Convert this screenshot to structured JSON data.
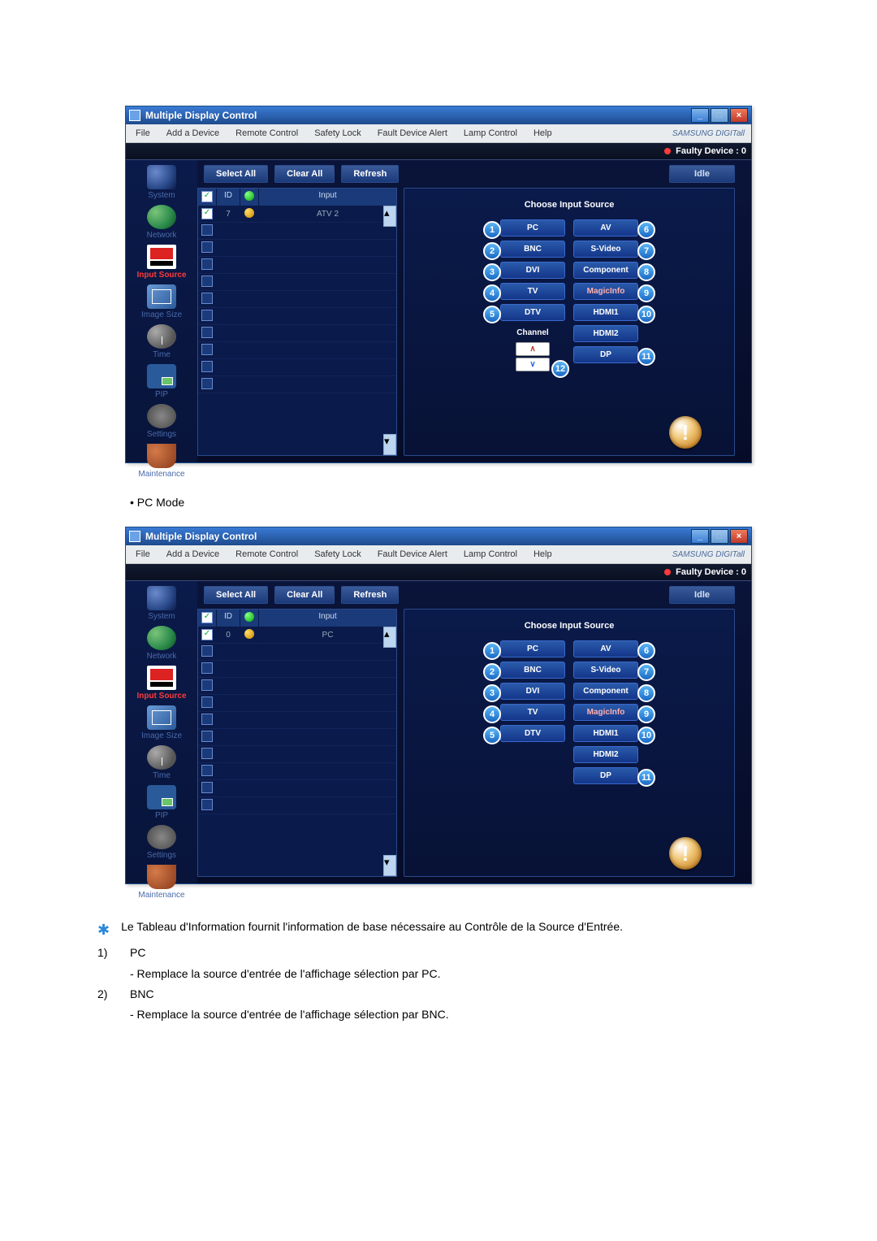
{
  "window": {
    "title": "Multiple Display Control",
    "brand": "SAMSUNG DIGITall"
  },
  "menu": [
    "File",
    "Add a Device",
    "Remote Control",
    "Safety Lock",
    "Fault Device Alert",
    "Lamp Control",
    "Help"
  ],
  "faulty": "Faulty Device : 0",
  "toolbar": {
    "select_all": "Select All",
    "clear_all": "Clear All",
    "refresh": "Refresh",
    "idle": "Idle"
  },
  "sidebar": [
    {
      "label": "System"
    },
    {
      "label": "Network"
    },
    {
      "label": "Input Source",
      "active": true
    },
    {
      "label": "Image Size"
    },
    {
      "label": "Time"
    },
    {
      "label": "PIP"
    },
    {
      "label": "Settings"
    },
    {
      "label": "Maintenance"
    }
  ],
  "grid": {
    "head": {
      "id": "ID",
      "input": "Input"
    },
    "row1_a": {
      "id": "7",
      "input": "ATV 2"
    },
    "row1_b": {
      "id": "0",
      "input": "PC"
    }
  },
  "panel": {
    "title": "Choose Input Source",
    "left": [
      "PC",
      "BNC",
      "DVI",
      "TV",
      "DTV"
    ],
    "right": [
      "AV",
      "S-Video",
      "Component",
      "MagicInfo",
      "HDMI1",
      "HDMI2",
      "DP"
    ],
    "left_nums": [
      "1",
      "2",
      "3",
      "4",
      "5"
    ],
    "right_nums": [
      "6",
      "7",
      "8",
      "9",
      "10",
      "",
      "11"
    ],
    "channel": "Channel",
    "ch_badge": "12"
  },
  "caption": "PC Mode",
  "notes": {
    "star": "Le Tableau d'Information fournit l'information de base nécessaire au Contrôle de la Source d'Entrée.",
    "n1_title": "PC",
    "n1_body": "- Remplace la source d'entrée de l'affichage sélection par PC.",
    "n2_title": "BNC",
    "n2_body": "- Remplace la source d'entrée de l'affichage sélection par BNC."
  }
}
